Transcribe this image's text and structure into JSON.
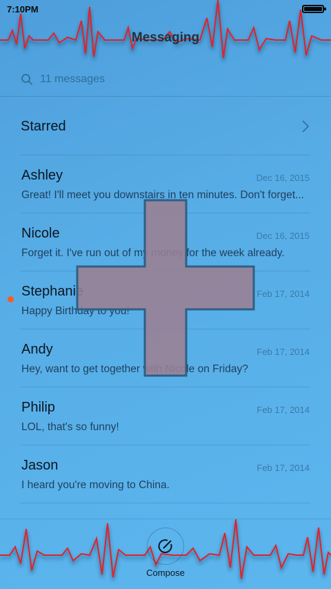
{
  "status_bar": {
    "time": "7:10PM"
  },
  "header": {
    "title": "Messaging"
  },
  "search": {
    "placeholder": "11 messages"
  },
  "starred": {
    "label": "Starred"
  },
  "conversations": [
    {
      "name": "Ashley",
      "date": "Dec 16, 2015",
      "snippet": "Great! I'll meet you downstairs in ten minutes. Don't forget...",
      "unread": false
    },
    {
      "name": "Nicole",
      "date": "Dec 16, 2015",
      "snippet": "Forget it. I've run out of my money for the week already.",
      "unread": false
    },
    {
      "name": "Stephanie",
      "date": "Feb 17, 2014",
      "snippet": "Happy Birthday to you!",
      "unread": true
    },
    {
      "name": "Andy",
      "date": "Feb 17, 2014",
      "snippet": "Hey, want to get together with Nicole on Friday?",
      "unread": false
    },
    {
      "name": "Philip",
      "date": "Feb 17, 2014",
      "snippet": "LOL, that's so funny!",
      "unread": false
    },
    {
      "name": "Jason",
      "date": "Feb 17, 2014",
      "snippet": "I heard you're moving to China.",
      "unread": false
    }
  ],
  "bottom_bar": {
    "compose_label": "Compose"
  },
  "colors": {
    "background_top": "#4d9edb",
    "background_bottom": "#5cb6ee",
    "unread_dot": "#ff5a1f",
    "ecg_line": "#e0202a",
    "plus_overlay": "#9b7f92"
  },
  "icons": {
    "search": "search-icon",
    "chevron": "chevron-right-icon",
    "compose": "compose-icon",
    "battery": "battery-icon"
  }
}
